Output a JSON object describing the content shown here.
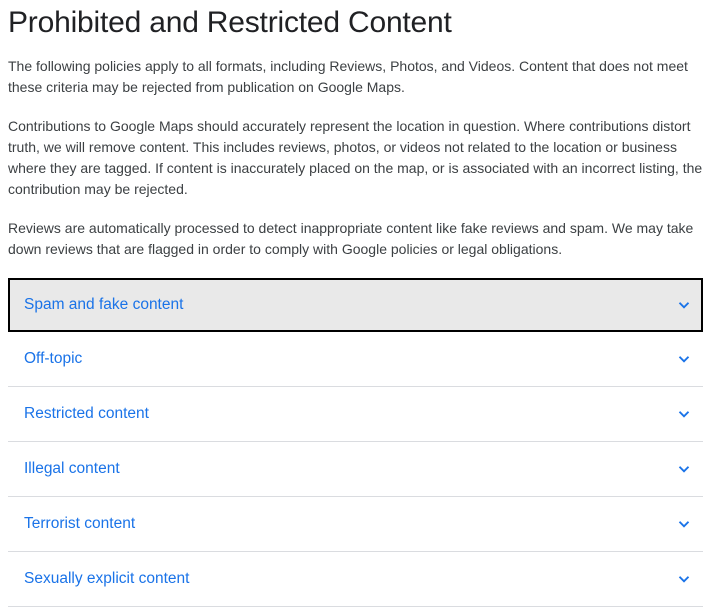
{
  "heading": "Prohibited and Restricted Content",
  "paragraphs": {
    "p1": "The following policies apply to all formats, including Reviews, Photos, and Videos. Content that does not meet these criteria may be rejected from publication on Google Maps.",
    "p2": "Contributions to Google Maps should accurately represent the location in question. Where contributions distort truth, we will remove content. This includes reviews, photos, or videos not related to the location or business where they are tagged. If content is inaccurately placed on the map, or is associated with an incorrect listing, the contribution may be rejected.",
    "p3": "Reviews are automatically processed to detect inappropriate content like fake reviews and spam. We may take down reviews that are flagged in order to comply with Google policies or legal obligations."
  },
  "accordion": {
    "items": [
      {
        "label": "Spam and fake content"
      },
      {
        "label": "Off-topic"
      },
      {
        "label": "Restricted content"
      },
      {
        "label": "Illegal content"
      },
      {
        "label": "Terrorist content"
      },
      {
        "label": "Sexually explicit content"
      }
    ]
  }
}
